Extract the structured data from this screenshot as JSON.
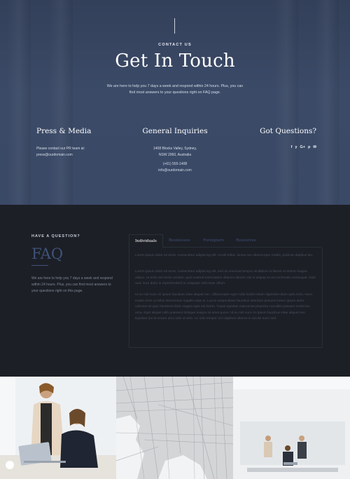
{
  "hero": {
    "eyebrow": "CONTACT US",
    "title": "Get In Touch",
    "intro": "We are here to help you 7 days a week and respond within 24 hours. Plus, you can find most answers to your questions right on FAQ page."
  },
  "press": {
    "title": "Press & Media",
    "text": "Please contact our PR team at:",
    "email": "press@ourdomain.com"
  },
  "general": {
    "title": "General Inquiries",
    "address_line1": "1408 Blocks Valley, Sydney,",
    "address_line2": "NSW 2060, Australia",
    "phone": "(+61) 555-1408",
    "email": "info@ourdomain.com"
  },
  "questions": {
    "title": "Got Questions?",
    "social_icons": [
      "facebook-icon",
      "twitter-icon",
      "google-plus-icon",
      "pinterest-icon",
      "email-icon"
    ],
    "social_glyphs": [
      "f",
      "y",
      "G+",
      "p",
      "✉"
    ]
  },
  "faq": {
    "eyebrow": "HAVE A QUESTION?",
    "title": "FAQ",
    "text": "We are here to help you 7 days a week and respond within 24 hours. Plus, you can find most answers to your questions right on this page.",
    "tabs": [
      "Individuals",
      "Businesses",
      "Foreigners",
      "Resources"
    ],
    "active_tab": "Individuals",
    "paragraphs": [
      "Lorem ipsum dolor sit amet, consectetur adipiscing elit. Ut elit tellus, luctus nec ullamcorper mattis, pulvinar dapibus leo.",
      "Lorem ipsum dolor sit amet, consectetur adipiscing elit, sed do eiusmod tempor incididunt ut labore et dolore magna aliqua. Ut enim ad minim veniam, quis nostrud exercitation ullamco laboris nisi ut aliquip ex ea commodo consequat. Duis aute irure dolor in reprehenderit in voluptate velit esse cillum.",
      "Id eu nisl nunc mi ipsum faucibus vitae aliquet nec. Ullamcorper eget nulla facilisi etiam dignissim diam quis enim. Nunc mattis enim ut tellus elementum sagittis vitae et. Lacus suspendisse faucibus interdum posuere lorem ipsum dolor. Ultricies mi quis hendrerit dolor magna eget est lorem. Turpis egestas maecenas pharetra convallis posuere morbi leo urna. Eget aliquet nibh praesent tristique magna sit amet purus. Id eu nisl nunc mi ipsum faucibus vitae aliquet nec. Egestas dui id ornare arcu odio ut sem. Ac odio tempor orci dapibus ultrices in iaculis nunc sed."
    ]
  },
  "colors": {
    "hero_bg": "#36435f",
    "dark_bg": "#1c1f26",
    "accent": "#3f5278"
  }
}
